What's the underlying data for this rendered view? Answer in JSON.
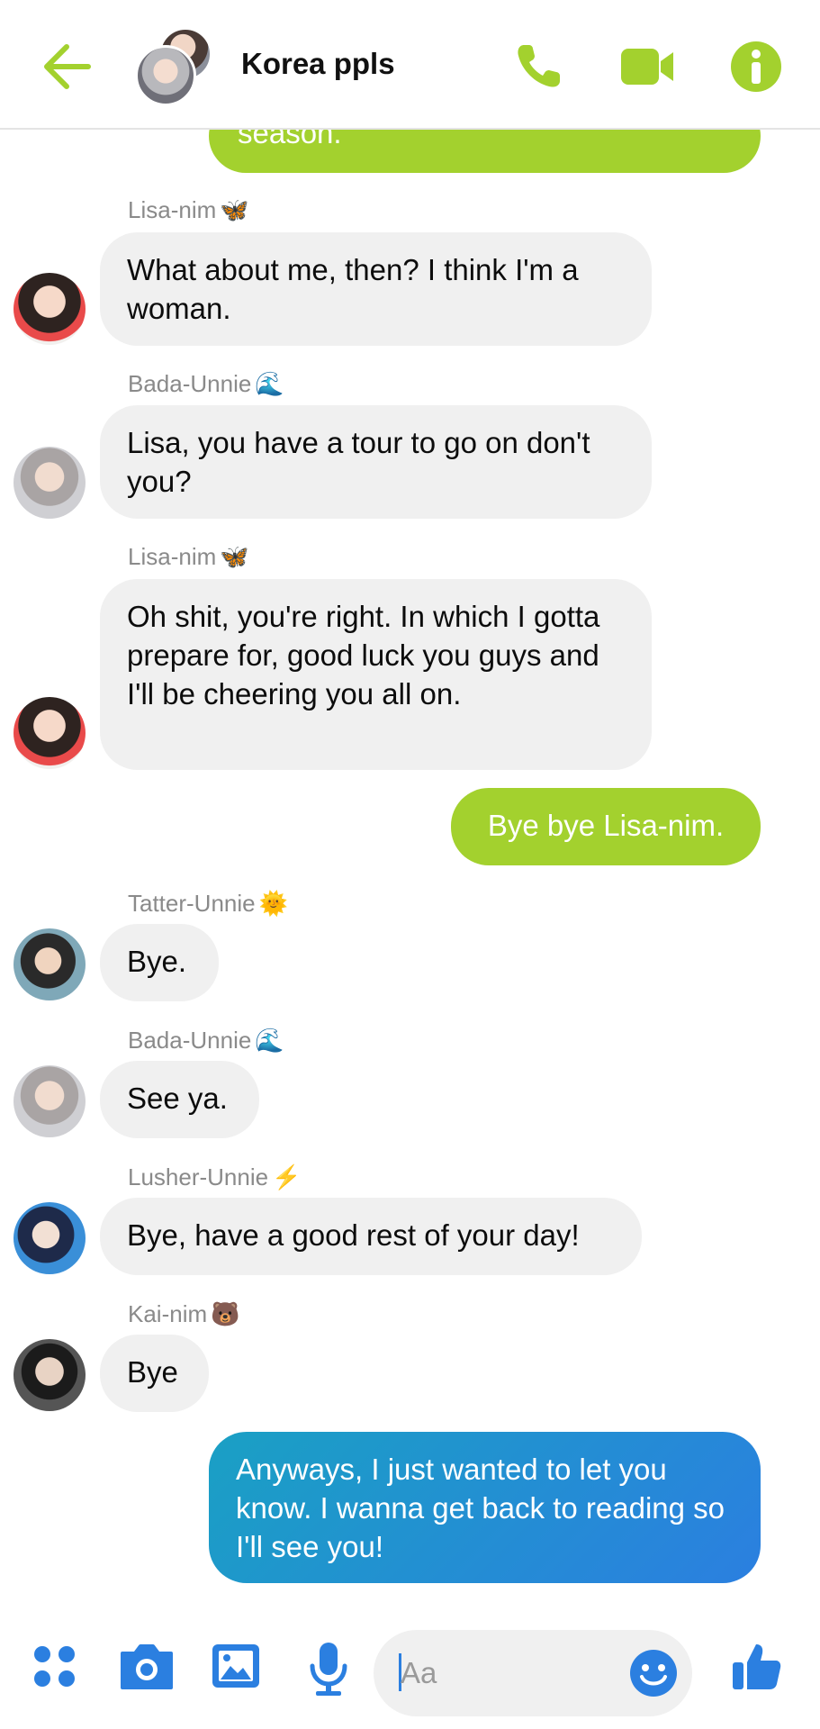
{
  "header": {
    "title": "Korea ppls",
    "accent_color": "#a3d12e"
  },
  "messages": [
    {
      "type": "outgoing",
      "color": "green",
      "text": "season."
    },
    {
      "type": "incoming",
      "sender": "Lisa-nim",
      "emoji": "🦋",
      "text": "What about me, then? I think I'm a woman."
    },
    {
      "type": "incoming",
      "sender": "Bada-Unnie",
      "emoji": "🌊",
      "text": "Lisa, you have a tour to go on don't you?"
    },
    {
      "type": "incoming",
      "sender": "Lisa-nim",
      "emoji": "🦋",
      "text": "Oh shit, you're right. In which I gotta prepare for, good luck you guys and I'll be cheering you all on."
    },
    {
      "type": "outgoing",
      "color": "green",
      "text": "Bye bye Lisa-nim."
    },
    {
      "type": "incoming",
      "sender": "Tatter-Unnie",
      "emoji": "🌞",
      "text": "Bye."
    },
    {
      "type": "incoming",
      "sender": "Bada-Unnie",
      "emoji": "🌊",
      "text": "See ya."
    },
    {
      "type": "incoming",
      "sender": "Lusher-Unnie",
      "emoji": "⚡",
      "text": "Bye, have a good rest of your day!"
    },
    {
      "type": "incoming",
      "sender": "Kai-nim",
      "emoji": "🐻",
      "text": "Bye"
    },
    {
      "type": "outgoing",
      "color": "blue",
      "text": "Anyways, I just wanted to let you know. I wanna get back to reading so I'll see you!"
    }
  ],
  "composer": {
    "placeholder": "Aa"
  },
  "icons": {
    "back": "arrow-left-icon",
    "call": "phone-icon",
    "video": "video-camera-icon",
    "info": "info-icon",
    "apps": "apps-grid-icon",
    "camera": "camera-icon",
    "gallery": "image-icon",
    "mic": "microphone-icon",
    "emoji": "smiley-icon",
    "like": "thumbs-up-icon"
  }
}
